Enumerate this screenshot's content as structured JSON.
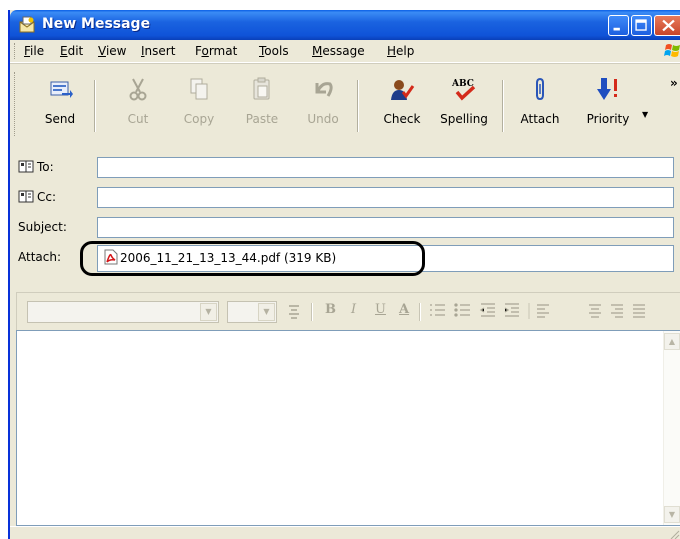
{
  "window": {
    "title": "New Message"
  },
  "menu": [
    {
      "label": "File",
      "u": "F",
      "rest": "ile"
    },
    {
      "label": "Edit",
      "u": "E",
      "rest": "dit"
    },
    {
      "label": "View",
      "u": "V",
      "rest": "iew"
    },
    {
      "label": "Insert",
      "u": "I",
      "rest": "nsert"
    },
    {
      "label": "Format",
      "pre": "F",
      "u": "o",
      "rest": "rmat"
    },
    {
      "label": "Tools",
      "u": "T",
      "rest": "ools"
    },
    {
      "label": "Message",
      "u": "M",
      "rest": "essage"
    },
    {
      "label": "Help",
      "u": "H",
      "rest": "elp"
    }
  ],
  "toolbar": {
    "send": "Send",
    "cut": "Cut",
    "copy": "Copy",
    "paste": "Paste",
    "undo": "Undo",
    "check": "Check",
    "spelling": "Spelling",
    "spelling_icon_text": "ABC",
    "attach": "Attach",
    "priority": "Priority",
    "more": "»"
  },
  "header": {
    "to_label": "To:",
    "cc_label": "Cc:",
    "subject_label": "Subject:",
    "attach_label": "Attach:",
    "to_value": "",
    "cc_value": "",
    "subject_value": "",
    "attachment": "2006_11_21_13_13_44.pdf (319 KB)"
  },
  "format": {
    "bold": "B",
    "italic": "I",
    "underline": "U",
    "font_color": "A"
  },
  "colors": {
    "titlebar": "#1a63e0",
    "face": "#ece9d8",
    "field_border": "#7f9db9"
  }
}
